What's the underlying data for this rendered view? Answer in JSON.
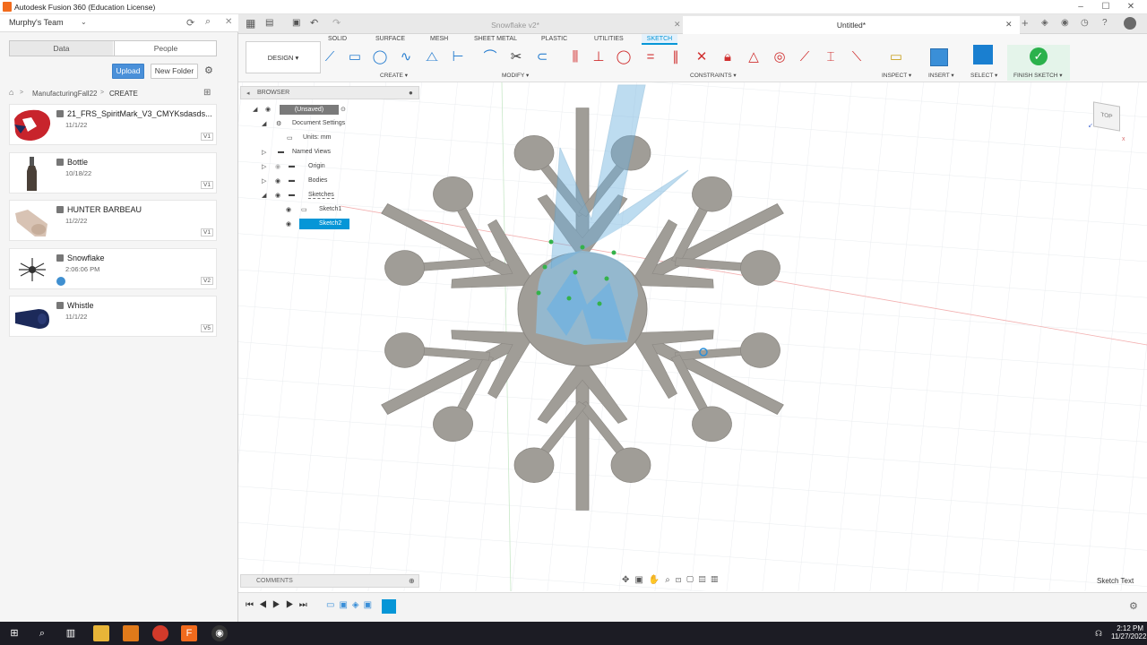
{
  "window": {
    "title": "Autodesk Fusion 360 (Education License)"
  },
  "team": {
    "name": "Murphy's Team",
    "chevron_icon": "chevron-down-icon"
  },
  "data_panel": {
    "tabs": [
      {
        "label": "Data"
      },
      {
        "label": "People"
      }
    ],
    "upload_label": "Upload",
    "new_folder_label": "New Folder",
    "breadcrumb": {
      "project": "ManufacturingFall22",
      "folder": "CREATE"
    },
    "files": [
      {
        "name": "21_FRS_SpiritMark_V3_CMYKsdasds...",
        "date": "11/1/22",
        "version": "V1"
      },
      {
        "name": "Bottle",
        "date": "10/18/22",
        "version": "V1"
      },
      {
        "name": "HUNTER BARBEAU",
        "date": "11/2/22",
        "version": "V1"
      },
      {
        "name": "Snowflake",
        "date": "2:06:06 PM",
        "version": "V2"
      },
      {
        "name": "Whistle",
        "date": "11/1/22",
        "version": "V5"
      }
    ]
  },
  "doc_tabs": [
    {
      "label": "Snowflake v2*",
      "active": false
    },
    {
      "label": "Untitled*",
      "active": true
    }
  ],
  "toolbar": {
    "workspace": "DESIGN",
    "tabs": [
      "SOLID",
      "SURFACE",
      "MESH",
      "SHEET METAL",
      "PLASTIC",
      "UTILITIES",
      "SKETCH"
    ],
    "active_tab": "SKETCH",
    "groups": {
      "create": "CREATE",
      "modify": "MODIFY",
      "constraints": "CONSTRAINTS",
      "inspect": "INSPECT",
      "insert": "INSERT",
      "select": "SELECT",
      "finish": "FINISH SKETCH"
    }
  },
  "browser": {
    "title": "BROWSER",
    "root": "(Unsaved)",
    "items": [
      "Document Settings",
      "Units: mm",
      "Named Views",
      "Origin",
      "Bodies",
      "Sketches",
      "Sketch1",
      "Sketch2"
    ]
  },
  "viewcube": {
    "face": "TOP"
  },
  "comments": {
    "label": "COMMENTS"
  },
  "status": {
    "text": "Sketch Text"
  },
  "taskbar": {
    "time": "2:12 PM",
    "date": "11/27/2022"
  },
  "colors": {
    "accent": "#0696d7",
    "finish_green": "#2bb14c",
    "sketch_blue": "#6fb2e0",
    "body_gray": "#a09d97"
  }
}
